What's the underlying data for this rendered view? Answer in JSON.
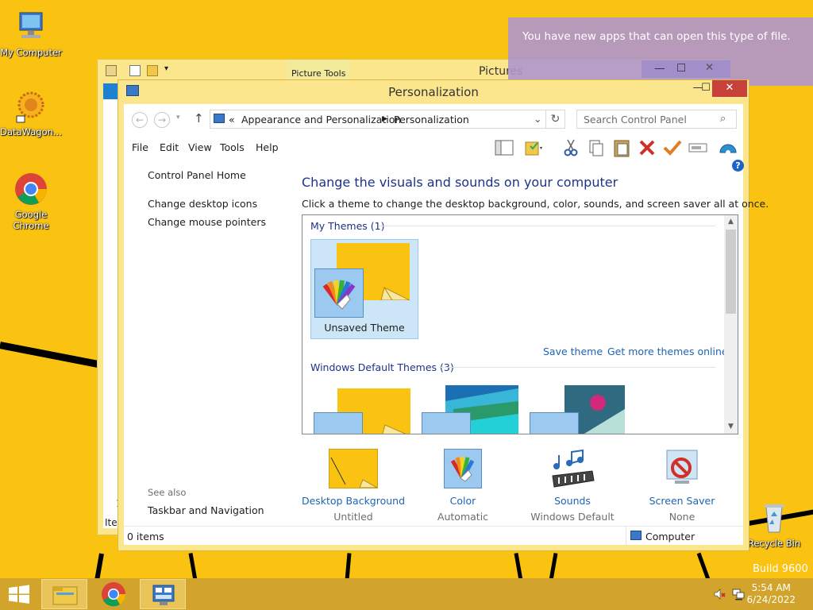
{
  "desktop": {
    "icons": [
      {
        "label": "My Computer",
        "icon": "computer-icon"
      },
      {
        "label": "DataWagon...",
        "icon": "datawagon-icon"
      },
      {
        "label": "Google Chrome",
        "icon": "chrome-icon"
      },
      {
        "label": "Recycle Bin",
        "icon": "recycle-bin-icon"
      }
    ],
    "build_text": "Build 9600"
  },
  "toast": {
    "message": "You have new apps that can open this type of file."
  },
  "back_window": {
    "ribbon_tab": "Picture Tools",
    "title": "Pictures",
    "left_items": [
      "1",
      "Iter"
    ]
  },
  "window": {
    "title": "Personalization",
    "address": {
      "root_marker": "«",
      "crumbs": [
        "Appearance and Personalization",
        "Personalization"
      ]
    },
    "search": {
      "placeholder": "Search Control Panel"
    },
    "menu": [
      "File",
      "Edit",
      "View",
      "Tools",
      "Help"
    ],
    "toolbar_icons": [
      "layout-icon",
      "folder-check-icon",
      "cut-icon",
      "copy-icon",
      "paste-icon",
      "delete-icon",
      "checkmark-icon",
      "rename-icon",
      "shell-icon"
    ],
    "left_pane": {
      "home": "Control Panel Home",
      "links": [
        "Change desktop icons",
        "Change mouse pointers"
      ],
      "see_also_header": "See also",
      "see_also": [
        "Taskbar and Navigation"
      ]
    },
    "main": {
      "heading": "Change the visuals and sounds on your computer",
      "subheading": "Click a theme to change the desktop background, color, sounds, and screen saver all at once.",
      "my_themes_header": "My Themes (1)",
      "my_themes": [
        {
          "label": "Unsaved Theme"
        }
      ],
      "save_theme": "Save theme",
      "get_more": "Get more themes online",
      "default_themes_header": "Windows Default Themes (3)"
    },
    "bottom": [
      {
        "label": "Desktop Background",
        "value": "Untitled",
        "icon": "desktop-background-icon"
      },
      {
        "label": "Color",
        "value": "Automatic",
        "icon": "color-icon"
      },
      {
        "label": "Sounds",
        "value": "Windows Default",
        "icon": "sounds-icon"
      },
      {
        "label": "Screen Saver",
        "value": "None",
        "icon": "screen-saver-icon"
      }
    ],
    "status": {
      "items": "0 items",
      "location": "Computer"
    }
  },
  "taskbar": {
    "time": "5:54 AM",
    "date": "6/24/2022"
  },
  "colors": {
    "desktop": "#fbc311",
    "window_frame": "#fbe68e",
    "link": "#1e64b4",
    "heading": "#1e3287",
    "close": "#c7413a"
  }
}
